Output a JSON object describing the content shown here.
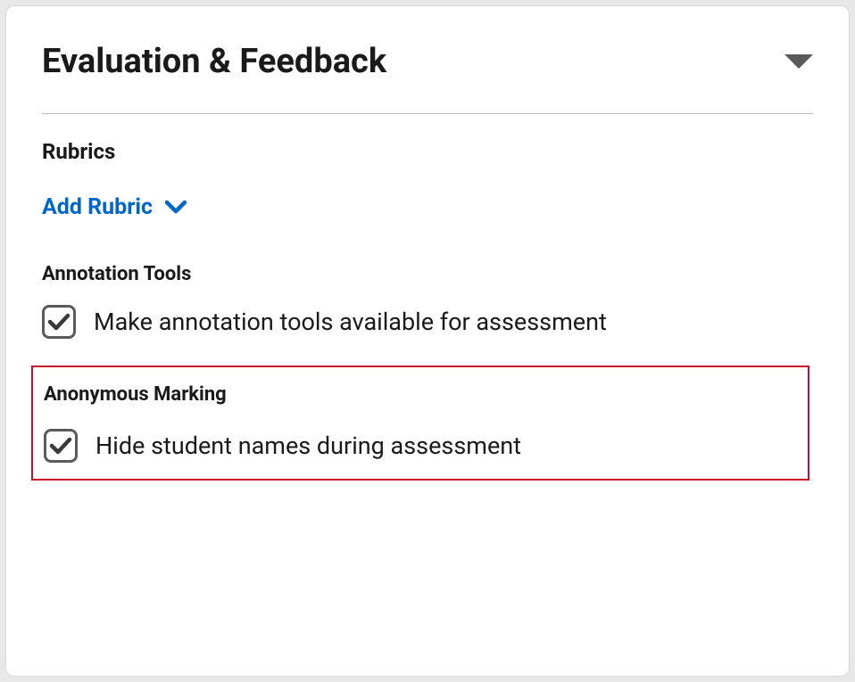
{
  "panel": {
    "title": "Evaluation & Feedback"
  },
  "rubrics": {
    "label": "Rubrics",
    "add_label": "Add Rubric"
  },
  "annotation": {
    "label": "Annotation Tools",
    "checkbox_label": "Make annotation tools available for assessment",
    "checked": true
  },
  "anonymous": {
    "label": "Anonymous Marking",
    "checkbox_label": "Hide student names during assessment",
    "checked": true
  }
}
